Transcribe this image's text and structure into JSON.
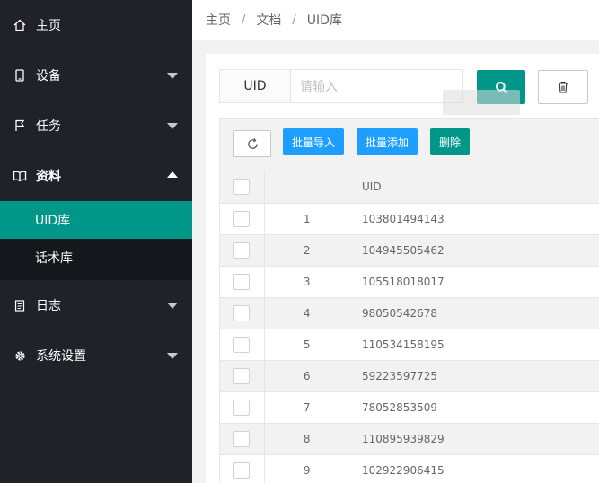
{
  "sidebar": {
    "items": [
      {
        "label": "主页",
        "icon": "home-icon"
      },
      {
        "label": "设备",
        "icon": "tablet-icon"
      },
      {
        "label": "任务",
        "icon": "flag-icon"
      },
      {
        "label": "资料",
        "icon": "book-icon"
      },
      {
        "label": "日志",
        "icon": "clipboard-icon"
      },
      {
        "label": "系统设置",
        "icon": "gear-icon"
      }
    ],
    "sub_items": [
      {
        "label": "UID库"
      },
      {
        "label": "话术库"
      }
    ]
  },
  "breadcrumb": {
    "items": [
      "主页",
      "文档",
      "UID库"
    ],
    "separator": "/"
  },
  "search": {
    "label": "UID",
    "placeholder": "请输入"
  },
  "toolbar": {
    "import_label": "批量导入",
    "add_label": "批量添加",
    "delete_label": "删除"
  },
  "table": {
    "header_uid": "UID",
    "rows": [
      {
        "no": "1",
        "uid": "103801494143"
      },
      {
        "no": "2",
        "uid": "104945505462"
      },
      {
        "no": "3",
        "uid": "105518018017"
      },
      {
        "no": "4",
        "uid": "98050542678"
      },
      {
        "no": "5",
        "uid": "110534158195"
      },
      {
        "no": "6",
        "uid": "59223597725"
      },
      {
        "no": "7",
        "uid": "78052853509"
      },
      {
        "no": "8",
        "uid": "110895939829"
      },
      {
        "no": "9",
        "uid": "102922906415"
      }
    ]
  },
  "colors": {
    "sidebar_bg": "#20222a",
    "accent_green": "#009688",
    "accent_blue": "#1e9fff"
  }
}
